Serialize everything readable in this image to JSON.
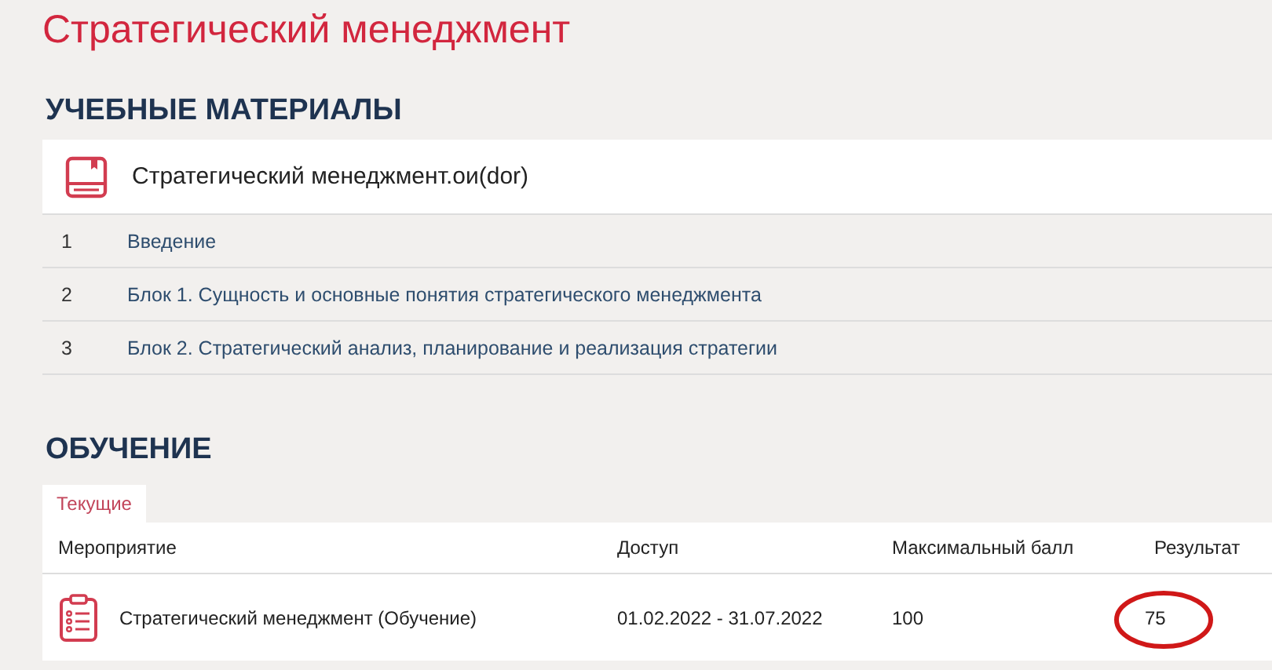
{
  "title": "Стратегический менеджмент",
  "materials": {
    "heading": "УЧЕБНЫЕ МАТЕРИАЛЫ",
    "course": "Стратегический менеджмент.ои(dor)",
    "items": [
      {
        "number": "1",
        "label": "Введение"
      },
      {
        "number": "2",
        "label": "Блок 1. Сущность и основные понятия стратегического менеджмента"
      },
      {
        "number": "3",
        "label": "Блок 2. Стратегический анализ, планирование и реализация стратегии"
      }
    ]
  },
  "training": {
    "heading": "ОБУЧЕНИЕ",
    "tabs": [
      {
        "label": "Текущие",
        "selected": true
      }
    ],
    "columns": [
      "Мероприятие",
      "Доступ",
      "Максимальный балл",
      "Результат"
    ],
    "rows": [
      {
        "activity": "Стратегический менеджмент (Обучение)",
        "access": "01.02.2022 - 31.07.2022",
        "max_score": "100",
        "result": "75",
        "circled": true
      }
    ]
  }
}
